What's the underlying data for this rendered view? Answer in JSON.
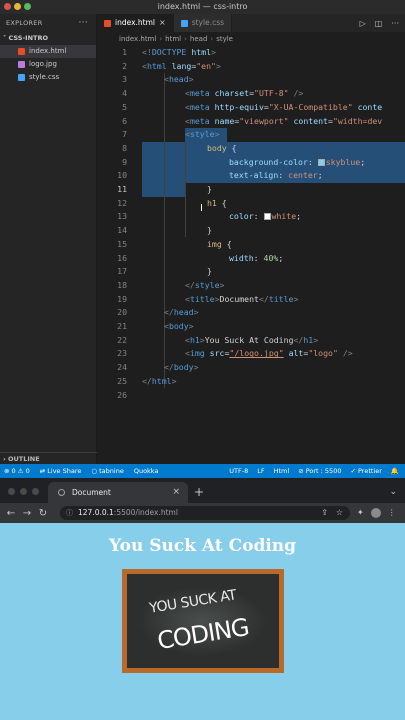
{
  "window_title": "index.html — css-intro",
  "sidebar": {
    "header": "EXPLORER",
    "more": "···",
    "folder": "CSS-INTRO",
    "files": [
      {
        "name": "index.html",
        "icon": "html-file-icon"
      },
      {
        "name": "logo.jpg",
        "icon": "image-file-icon"
      },
      {
        "name": "style.css",
        "icon": "css-file-icon"
      }
    ],
    "outline": "OUTLINE"
  },
  "tabs": [
    {
      "label": "index.html",
      "close": "×"
    },
    {
      "label": "style.css",
      "close": ""
    }
  ],
  "breadcrumbs": [
    "index.html",
    "html",
    "head",
    "style"
  ],
  "editor": {
    "cursor_line": 11,
    "line_numbers": [
      "1",
      "2",
      "3",
      "4",
      "5",
      "6",
      "7",
      "8",
      "9",
      "10",
      "11",
      "12",
      "13",
      "14",
      "15",
      "16",
      "17",
      "18",
      "19",
      "20",
      "21",
      "22",
      "23",
      "24",
      "25",
      "26"
    ],
    "lines": {
      "l1": [
        "<!",
        "DOCTYPE",
        " ",
        "html",
        ">"
      ],
      "l2": [
        "<",
        "html",
        " ",
        "lang",
        "=",
        "\"en\"",
        ">"
      ],
      "l3": [
        "<",
        "head",
        ">"
      ],
      "l4": [
        "<",
        "meta",
        " ",
        "charset",
        "=",
        "\"UTF-8\"",
        " />"
      ],
      "l5": [
        "<",
        "meta",
        " ",
        "http-equiv",
        "=",
        "\"X-UA-Compatible\"",
        " ",
        "conte"
      ],
      "l6": [
        "<",
        "meta",
        " ",
        "name",
        "=",
        "\"viewport\"",
        " ",
        "content",
        "=",
        "\"width=dev"
      ],
      "l7": [
        "<",
        "style",
        ">"
      ],
      "l8": [
        "body",
        " {"
      ],
      "l9": [
        "background-color",
        ": ",
        "skyblue",
        ";"
      ],
      "l10": [
        "text-align",
        ": ",
        "center",
        ";"
      ],
      "l11": [
        "}"
      ],
      "l12": [
        "h1",
        " {"
      ],
      "l13": [
        "color",
        ": ",
        "white",
        ";"
      ],
      "l14": [
        "}"
      ],
      "l15": [
        "img",
        " {"
      ],
      "l16": [
        "width",
        ": ",
        "40%",
        ";"
      ],
      "l17": [
        "}"
      ],
      "l18": [
        "</",
        "style",
        ">"
      ],
      "l19": [
        "<",
        "title",
        ">",
        "Document",
        "</",
        "title",
        ">"
      ],
      "l20": [
        "</",
        "head",
        ">"
      ],
      "l21": [
        "<",
        "body",
        ">"
      ],
      "l22": [
        "<",
        "h1",
        ">",
        "You Suck At Coding",
        "</",
        "h1",
        ">"
      ],
      "l23": [
        "<",
        "img",
        " ",
        "src",
        "=",
        "\"/logo.jpg\"",
        " ",
        "alt",
        "=",
        "\"logo\"",
        " />"
      ],
      "l24": [
        "</",
        "body",
        ">"
      ],
      "l25": [
        "</",
        "html",
        ">"
      ]
    },
    "swatch_colors": {
      "skyblue": "#87ceeb",
      "white": "#ffffff"
    }
  },
  "statusbar": {
    "left": [
      "⊗ 0  ⚠ 0",
      "Live Share",
      "tabnine",
      "Quokka"
    ],
    "right": [
      "UTF-8",
      "LF",
      "Html",
      "Port : 5500",
      "Prettier"
    ]
  },
  "browser": {
    "tab_title": "Document",
    "tab_close": "×",
    "new_tab": "+",
    "url_host": "127.0.0.1",
    "url_path": ":5500/index.html",
    "page_heading": "You Suck At Coding",
    "logo_line1": "YOU SUCK AT",
    "logo_line2": "CODING"
  },
  "colors": {
    "accent": "#007acc",
    "selection": "#264f78",
    "page_background": "#87ceeb"
  }
}
